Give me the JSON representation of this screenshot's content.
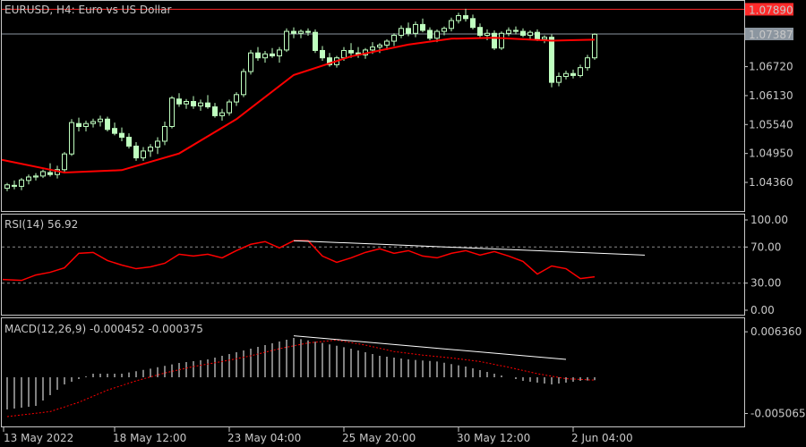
{
  "chart_data": [
    {
      "type": "candlestick",
      "title": "EURUSD, H4:  Euro vs US Dollar",
      "y_ticks": [
        "1.07890",
        "1.07387",
        "1.06720",
        "1.06130",
        "1.05540",
        "1.04950",
        "1.04360"
      ],
      "ylim": [
        1.0385,
        1.0797
      ],
      "ask_line": {
        "value": 1.0789,
        "label": "1.07890",
        "color": "#ff2a2a"
      },
      "bid_line": {
        "value": 1.07387,
        "label": "1.07387",
        "color": "#8c96a0"
      },
      "candle_color": "#bfffbf",
      "ma_color": "#ff0000",
      "series": [
        {
          "name": "candles",
          "ohlc": [
            [
              1.0424,
              1.0435,
              1.0418,
              1.0431
            ],
            [
              1.043,
              1.044,
              1.0422,
              1.0428
            ],
            [
              1.0428,
              1.0445,
              1.042,
              1.0441
            ],
            [
              1.044,
              1.0452,
              1.0432,
              1.0447
            ],
            [
              1.0447,
              1.0455,
              1.044,
              1.0449
            ],
            [
              1.0449,
              1.0462,
              1.0445,
              1.0458
            ],
            [
              1.0456,
              1.0475,
              1.0448,
              1.0452
            ],
            [
              1.0452,
              1.047,
              1.0444,
              1.0462
            ],
            [
              1.0462,
              1.0498,
              1.0458,
              1.0494
            ],
            [
              1.0494,
              1.0565,
              1.049,
              1.0558
            ],
            [
              1.0556,
              1.0568,
              1.054,
              1.055
            ],
            [
              1.055,
              1.0562,
              1.054,
              1.0556
            ],
            [
              1.0556,
              1.0566,
              1.0548,
              1.056
            ],
            [
              1.056,
              1.0572,
              1.055,
              1.0565
            ],
            [
              1.0565,
              1.057,
              1.054,
              1.0544
            ],
            [
              1.0546,
              1.0558,
              1.0532,
              1.0536
            ],
            [
              1.0536,
              1.0548,
              1.052,
              1.0528
            ],
            [
              1.0528,
              1.0536,
              1.0505,
              1.051
            ],
            [
              1.051,
              1.0518,
              1.048,
              1.0486
            ],
            [
              1.0486,
              1.0508,
              1.048,
              1.05
            ],
            [
              1.05,
              1.0514,
              1.0488,
              1.0508
            ],
            [
              1.0508,
              1.0528,
              1.0494,
              1.052
            ],
            [
              1.052,
              1.056,
              1.0512,
              1.055
            ],
            [
              1.055,
              1.0612,
              1.0546,
              1.0608
            ],
            [
              1.0606,
              1.0618,
              1.059,
              1.0596
            ],
            [
              1.0596,
              1.0606,
              1.0586,
              1.0601
            ],
            [
              1.0601,
              1.0612,
              1.0586,
              1.0592
            ],
            [
              1.0592,
              1.0605,
              1.0582,
              1.0598
            ],
            [
              1.0598,
              1.0614,
              1.0586,
              1.059
            ],
            [
              1.059,
              1.0598,
              1.0568,
              1.0572
            ],
            [
              1.0572,
              1.0586,
              1.0562,
              1.0578
            ],
            [
              1.0578,
              1.0605,
              1.0572,
              1.06
            ],
            [
              1.06,
              1.062,
              1.0592,
              1.0615
            ],
            [
              1.0615,
              1.0668,
              1.061,
              1.0662
            ],
            [
              1.0662,
              1.0706,
              1.0656,
              1.07
            ],
            [
              1.07,
              1.0712,
              1.0684,
              1.069
            ],
            [
              1.069,
              1.0704,
              1.068,
              1.0698
            ],
            [
              1.0698,
              1.071,
              1.069,
              1.0694
            ],
            [
              1.0694,
              1.0712,
              1.068,
              1.0706
            ],
            [
              1.0706,
              1.075,
              1.0702,
              1.0744
            ],
            [
              1.0744,
              1.0752,
              1.073,
              1.074
            ],
            [
              1.074,
              1.0748,
              1.073,
              1.0744
            ],
            [
              1.0744,
              1.075,
              1.0735,
              1.0742
            ],
            [
              1.0742,
              1.0748,
              1.07,
              1.0705
            ],
            [
              1.0705,
              1.0714,
              1.0684,
              1.069
            ],
            [
              1.069,
              1.07,
              1.0672,
              1.0676
            ],
            [
              1.0676,
              1.0694,
              1.067,
              1.069
            ],
            [
              1.069,
              1.0712,
              1.0684,
              1.0705
            ],
            [
              1.0705,
              1.072,
              1.069,
              1.07
            ],
            [
              1.07,
              1.0712,
              1.069,
              1.0696
            ],
            [
              1.0696,
              1.071,
              1.0688,
              1.0706
            ],
            [
              1.0706,
              1.0722,
              1.0698,
              1.0712
            ],
            [
              1.0712,
              1.072,
              1.07,
              1.0716
            ],
            [
              1.0716,
              1.0728,
              1.0706,
              1.0724
            ],
            [
              1.0724,
              1.074,
              1.0714,
              1.0736
            ],
            [
              1.0736,
              1.0756,
              1.073,
              1.075
            ],
            [
              1.075,
              1.0762,
              1.0734,
              1.074
            ],
            [
              1.074,
              1.0764,
              1.0732,
              1.0758
            ],
            [
              1.0758,
              1.077,
              1.0742,
              1.0746
            ],
            [
              1.0746,
              1.0752,
              1.0726,
              1.073
            ],
            [
              1.073,
              1.0748,
              1.0722,
              1.0744
            ],
            [
              1.0744,
              1.0754,
              1.0736,
              1.075
            ],
            [
              1.075,
              1.0772,
              1.0744,
              1.0766
            ],
            [
              1.0766,
              1.0782,
              1.076,
              1.0776
            ],
            [
              1.0776,
              1.079,
              1.0764,
              1.077
            ],
            [
              1.077,
              1.0778,
              1.0748,
              1.0752
            ],
            [
              1.0752,
              1.076,
              1.0732,
              1.0736
            ],
            [
              1.0736,
              1.0748,
              1.0726,
              1.074
            ],
            [
              1.074,
              1.0746,
              1.0706,
              1.071
            ],
            [
              1.071,
              1.0744,
              1.0706,
              1.074
            ],
            [
              1.074,
              1.0752,
              1.0734,
              1.0746
            ],
            [
              1.0746,
              1.0754,
              1.0738,
              1.0744
            ],
            [
              1.0744,
              1.075,
              1.0732,
              1.0736
            ],
            [
              1.0736,
              1.0746,
              1.0728,
              1.0742
            ],
            [
              1.0742,
              1.0748,
              1.0724,
              1.0728
            ],
            [
              1.0728,
              1.0736,
              1.072,
              1.0732
            ],
            [
              1.0732,
              1.0738,
              1.063,
              1.064
            ],
            [
              1.064,
              1.066,
              1.0632,
              1.0652
            ],
            [
              1.0652,
              1.0664,
              1.0646,
              1.0658
            ],
            [
              1.0658,
              1.0666,
              1.0648,
              1.0654
            ],
            [
              1.0654,
              1.0676,
              1.065,
              1.067
            ],
            [
              1.067,
              1.0696,
              1.0664,
              1.069
            ],
            [
              1.069,
              1.074,
              1.0686,
              1.0738
            ]
          ]
        },
        {
          "name": "moving-average",
          "x": [
            0,
            8,
            16,
            24,
            32,
            40,
            48,
            56,
            62,
            68,
            76,
            82
          ],
          "y": [
            1.0482,
            1.0456,
            1.0461,
            1.0495,
            1.0565,
            1.0655,
            1.0693,
            1.0717,
            1.0729,
            1.0731,
            1.0725,
            1.0727
          ]
        }
      ],
      "x_ticks": [
        "13 May 2022",
        "18 May 12:00",
        "23 May 04:00",
        "25 May 20:00",
        "30 May 12:00",
        "2 Jun 04:00"
      ]
    },
    {
      "type": "line",
      "title": "RSI(14) 56.92",
      "y_ticks": [
        "100.00",
        "70.00",
        "30.00",
        "0.00"
      ],
      "ylim": [
        0,
        100
      ],
      "levels": [
        70,
        30
      ],
      "series": [
        {
          "name": "RSI",
          "color": "#ff0000",
          "x": [
            0,
            2,
            4,
            6,
            8,
            10,
            12,
            14,
            16,
            18,
            20,
            22,
            24,
            26,
            28,
            30,
            32,
            34,
            36,
            38,
            40,
            42,
            44,
            46,
            48,
            50,
            52,
            54,
            56,
            58,
            60,
            62,
            64,
            66,
            68,
            70,
            72,
            74,
            76,
            78,
            80,
            82
          ],
          "y": [
            34,
            33,
            39,
            42,
            47,
            63,
            64,
            55,
            50,
            46,
            48,
            52,
            62,
            60,
            62,
            58,
            66,
            73,
            76,
            69,
            77,
            77,
            60,
            53,
            58,
            64,
            68,
            63,
            66,
            60,
            58,
            63,
            66,
            61,
            65,
            60,
            54,
            40,
            49,
            46,
            35,
            37
          ]
        },
        {
          "name": "RSI-trendline",
          "color": "#ffffff",
          "x": [
            40,
            89
          ],
          "y": [
            77,
            61
          ]
        }
      ]
    },
    {
      "type": "bar",
      "title": "MACD(12,26,9) -0.000452 -0.000375",
      "y_ticks": [
        "0.006360",
        "-0.005065"
      ],
      "ylim": [
        -0.006,
        0.0075
      ],
      "bar_color": "#ffffff",
      "signal_color": "#ff0000",
      "series": [
        {
          "name": "MACD",
          "x": [
            0,
            4,
            8,
            12,
            16,
            20,
            24,
            28,
            32,
            36,
            40,
            44,
            48,
            52,
            56,
            60,
            64,
            68,
            72,
            76,
            80,
            82
          ],
          "y": [
            -0.0045,
            -0.004,
            -0.001,
            0.0005,
            0.0005,
            0.0012,
            0.002,
            0.0025,
            0.0035,
            0.0045,
            0.0055,
            0.0048,
            0.004,
            0.003,
            0.0025,
            0.0022,
            0.0015,
            0.0005,
            -0.0005,
            -0.001,
            -0.0005,
            -0.0004
          ]
        },
        {
          "name": "Signal",
          "x": [
            0,
            6,
            10,
            14,
            18,
            22,
            26,
            30,
            34,
            38,
            42,
            46,
            50,
            54,
            58,
            62,
            66,
            70,
            74,
            78,
            82
          ],
          "y": [
            -0.0055,
            -0.0048,
            -0.0035,
            -0.0018,
            -0.0005,
            0.0006,
            0.0015,
            0.0022,
            0.003,
            0.004,
            0.0048,
            0.0052,
            0.0045,
            0.0036,
            0.0031,
            0.0027,
            0.0022,
            0.0014,
            0.0005,
            -0.0002,
            -0.0004
          ]
        },
        {
          "name": "MACD-trendline",
          "x": [
            40,
            78
          ],
          "y": [
            0.0058,
            0.0025
          ]
        }
      ]
    }
  ]
}
